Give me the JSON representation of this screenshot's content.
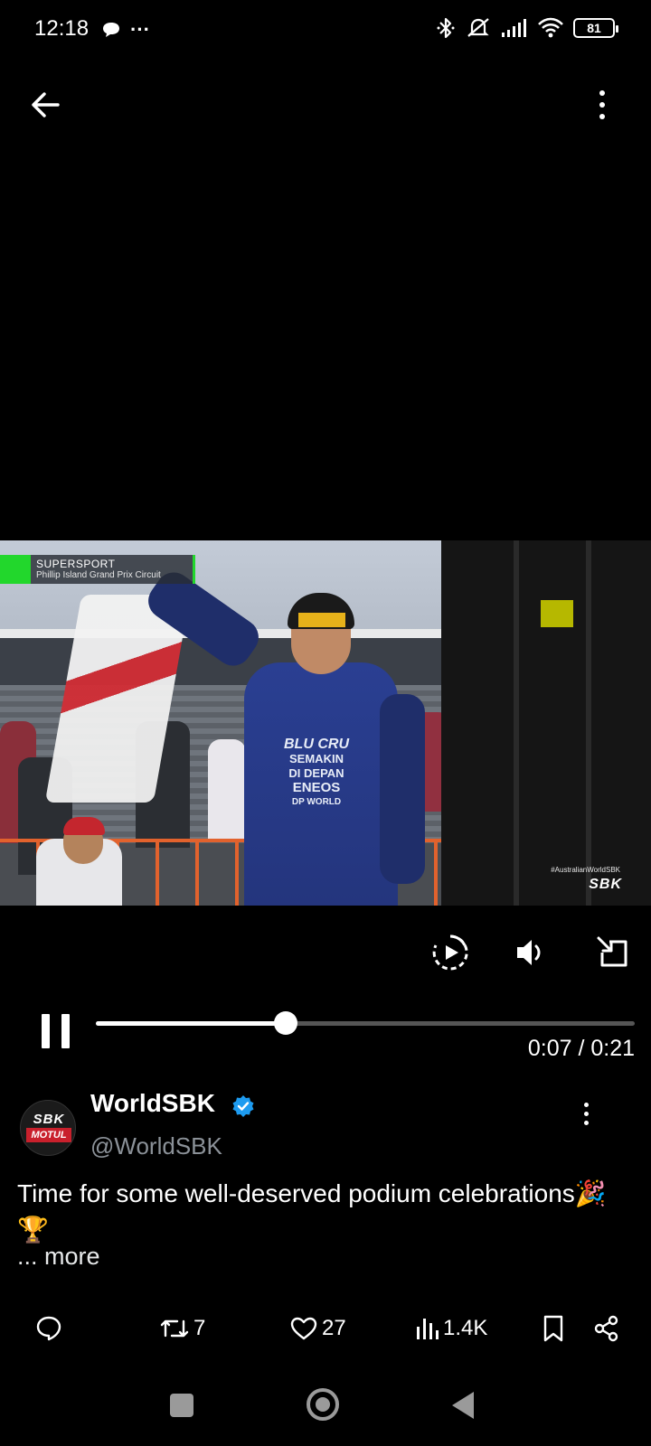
{
  "status_bar": {
    "time": "12:18",
    "ellipsis": "···",
    "battery": "81"
  },
  "video": {
    "overlay_series": "SUPERSPORT",
    "overlay_circuit": "Phillip Island Grand Prix Circuit",
    "hashtag": "#AustralianWorldSBK",
    "broadcaster_logo": "SBK",
    "rider_suit_text": [
      "BLU CRU",
      "SEMAKIN",
      "DI DEPAN",
      "ENEOS",
      "DP WORLD"
    ]
  },
  "player": {
    "progress": 0.352,
    "time_readout": "0:07 / 0:21"
  },
  "tweet": {
    "display_name": "WorldSBK",
    "handle": "@WorldSBK",
    "avatar_top": "SBK",
    "avatar_bottom": "MOTUL",
    "text": "Time for some well-deserved podium celebrations🎉🏆",
    "more_label": "... more"
  },
  "actions": {
    "reposts": "7",
    "likes": "27",
    "views": "1.4K"
  },
  "colors": {
    "background": "#000000",
    "verified_blue": "#1d9bf0",
    "overlay_green": "#22d72c",
    "muted_text": "#8b9198"
  }
}
